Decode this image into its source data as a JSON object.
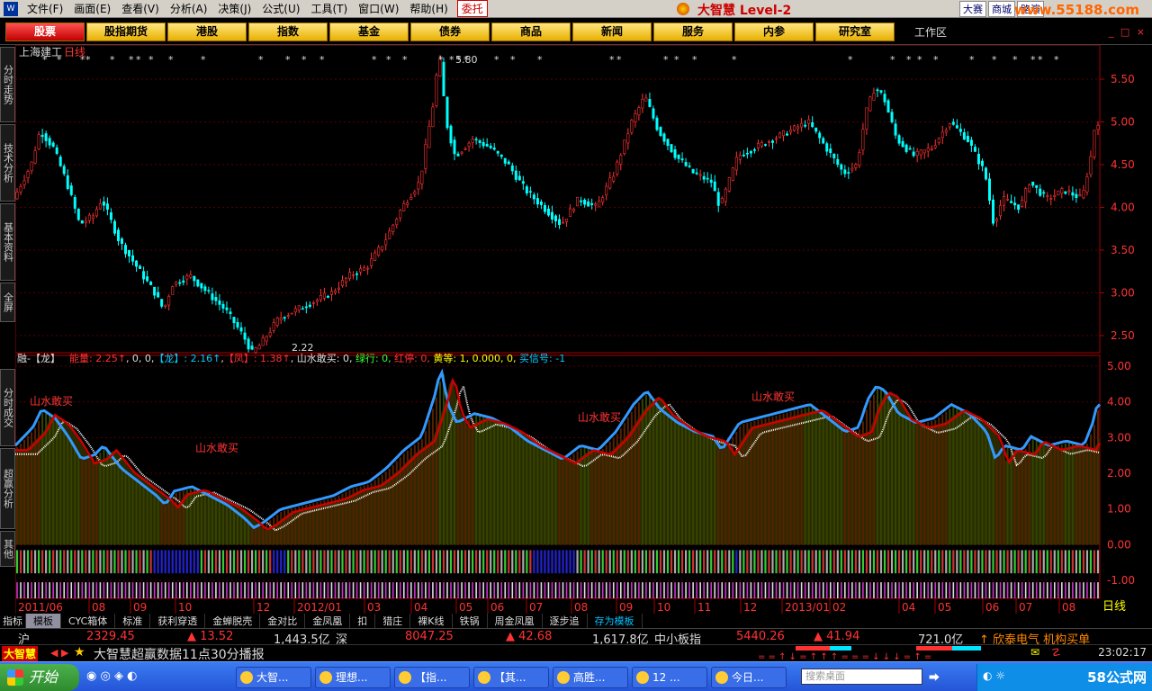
{
  "menubar": {
    "items": [
      "文件(F)",
      "画面(E)",
      "查看(V)",
      "分析(A)",
      "决策(J)",
      "公式(U)",
      "工具(T)",
      "窗口(W)",
      "帮助(H)"
    ],
    "weituo": "委托",
    "brand": "大智慧 Level-2",
    "links": [
      "大赛",
      "商城",
      "路演"
    ],
    "site": "www.55188.com"
  },
  "toolbar": {
    "buttons": [
      "股票",
      "股指期货",
      "港股",
      "指数",
      "基金",
      "债券",
      "商品",
      "新闻",
      "服务",
      "内参",
      "研究室"
    ],
    "active": "股票",
    "workarea": "工作区",
    "winctl": "_ □ ×"
  },
  "sidetabs": [
    "分时走势",
    "技术分析",
    "基本资料",
    "全屏",
    "分时成交",
    "超赢分析",
    "其他"
  ],
  "chart_data": {
    "type": "candlestick",
    "stock_name": "上海建工",
    "period": "日线",
    "price_axis": {
      "ticks": [
        "5.50",
        "5.00",
        "4.50",
        "4.00",
        "3.50",
        "3.00",
        "2.50"
      ],
      "range": [
        2.3,
        5.9
      ]
    },
    "high_label": "5.80",
    "low_label": "2.22",
    "x_labels": [
      "2011/06",
      "08",
      "09",
      "10",
      "12",
      "2012/01",
      "03",
      "04",
      "05",
      "06",
      "07",
      "08",
      "09",
      "10",
      "11",
      "12",
      "2013/01",
      "02",
      "04",
      "05",
      "06",
      "07",
      "08"
    ],
    "close_path": [
      [
        0,
        4.1
      ],
      [
        0.02,
        4.5
      ],
      [
        0.03,
        4.9
      ],
      [
        0.045,
        4.7
      ],
      [
        0.06,
        4.3
      ],
      [
        0.075,
        3.8
      ],
      [
        0.09,
        3.9
      ],
      [
        0.1,
        4.1
      ],
      [
        0.12,
        3.6
      ],
      [
        0.14,
        3.3
      ],
      [
        0.16,
        3.0
      ],
      [
        0.17,
        2.8
      ],
      [
        0.18,
        3.1
      ],
      [
        0.2,
        3.2
      ],
      [
        0.22,
        3.0
      ],
      [
        0.24,
        2.8
      ],
      [
        0.26,
        2.5
      ],
      [
        0.27,
        2.3
      ],
      [
        0.28,
        2.4
      ],
      [
        0.3,
        2.7
      ],
      [
        0.32,
        2.8
      ],
      [
        0.34,
        2.9
      ],
      [
        0.36,
        3.0
      ],
      [
        0.38,
        3.2
      ],
      [
        0.4,
        3.3
      ],
      [
        0.42,
        3.6
      ],
      [
        0.44,
        4.0
      ],
      [
        0.46,
        4.3
      ],
      [
        0.475,
        5.2
      ],
      [
        0.482,
        5.8
      ],
      [
        0.49,
        5.0
      ],
      [
        0.5,
        4.6
      ],
      [
        0.52,
        4.8
      ],
      [
        0.54,
        4.7
      ],
      [
        0.56,
        4.5
      ],
      [
        0.58,
        4.2
      ],
      [
        0.6,
        4.0
      ],
      [
        0.62,
        3.8
      ],
      [
        0.64,
        4.1
      ],
      [
        0.66,
        4.0
      ],
      [
        0.68,
        4.4
      ],
      [
        0.7,
        5.0
      ],
      [
        0.715,
        5.3
      ],
      [
        0.73,
        4.9
      ],
      [
        0.75,
        4.6
      ],
      [
        0.77,
        4.4
      ],
      [
        0.79,
        4.3
      ],
      [
        0.8,
        4.0
      ],
      [
        0.82,
        4.6
      ],
      [
        0.84,
        4.7
      ],
      [
        0.86,
        4.8
      ],
      [
        0.88,
        4.9
      ],
      [
        0.9,
        5.0
      ],
      [
        0.92,
        4.7
      ],
      [
        0.94,
        4.4
      ],
      [
        0.955,
        4.5
      ],
      [
        0.965,
        5.1
      ],
      [
        0.975,
        5.4
      ],
      [
        0.985,
        5.3
      ],
      [
        1.0,
        4.8
      ],
      [
        1.02,
        4.6
      ],
      [
        1.04,
        4.7
      ],
      [
        1.06,
        5.0
      ],
      [
        1.08,
        4.8
      ],
      [
        1.1,
        4.4
      ],
      [
        1.11,
        3.8
      ],
      [
        1.12,
        4.1
      ],
      [
        1.14,
        4.0
      ],
      [
        1.15,
        4.3
      ],
      [
        1.17,
        4.1
      ],
      [
        1.19,
        4.2
      ],
      [
        1.21,
        4.1
      ],
      [
        1.22,
        4.6
      ],
      [
        1.225,
        5.0
      ]
    ],
    "indicator": {
      "name": "融-【龙】",
      "legend": [
        {
          "t": "能量:",
          "c": "#ff3333"
        },
        {
          "t": " 2.25↑",
          "c": "#ff3333"
        },
        {
          "t": ", 0, 0,",
          "c": "#dddddd"
        },
        {
          "t": "【龙】",
          "c": "#00ccff"
        },
        {
          "t": ": 2.16↑",
          "c": "#00ccff"
        },
        {
          "t": ",",
          "c": "#dddddd"
        },
        {
          "t": "【凤】",
          "c": "#ff3333"
        },
        {
          "t": ": 1.38↑",
          "c": "#ff3333"
        },
        {
          "t": ", 山水敢买: 0,",
          "c": "#dddddd"
        },
        {
          "t": " 绿行: 0,",
          "c": "#33ff33"
        },
        {
          "t": " 红停: 0,",
          "c": "#ff3333"
        },
        {
          "t": " 黄等: 1, 0.000, 0,",
          "c": "#ffff00"
        },
        {
          "t": " 买信号: -1",
          "c": "#00ccff"
        }
      ],
      "axis_ticks": [
        "5.00",
        "4.00",
        "3.00",
        "2.00",
        "1.00",
        "0.00",
        "-1.00"
      ],
      "range": [
        -1.5,
        5.3
      ],
      "annotations": [
        "山水敢买",
        "山水敢买",
        "山水敢买",
        "山水敢买"
      ]
    }
  },
  "tabbar": {
    "first": "指标",
    "sel": "模板",
    "items": [
      "CYC箱体",
      "标准",
      "获利穿透",
      "金蝉脱壳",
      "金对比",
      "金凤凰",
      "扣",
      "猎庄",
      "裸K线",
      "铁锅",
      "周金凤凰",
      "逐步追"
    ],
    "save": "存为模板"
  },
  "status": {
    "sh": "沪",
    "sh_idx": "2329.45",
    "sh_chg": "▲ 13.52",
    "sh_amt": "1,443.5亿",
    "sz": "深",
    "sz_idx": "8047.25",
    "sz_chg": "▲ 42.68",
    "sz_amt": "1,617.8亿",
    "zx": "中小板指",
    "zx_idx": "5440.26",
    "zx_chg": "▲ 41.94",
    "zx_amt": "721.0亿",
    "news": "↑ 欣泰电气 机构买单"
  },
  "ticker": {
    "logo": "大智慧",
    "text": "大智慧超赢数据11点30分播报",
    "clock": "23:02:17",
    "side": "日线"
  },
  "taskbar": {
    "start": "开始",
    "tasks": [
      "大智...",
      "理想...",
      "【指...",
      "【其...",
      "高胜...",
      "12 ...",
      "今日..."
    ],
    "search": "搜索桌面",
    "site": "58公式网"
  },
  "colors": {
    "up": "#ff3333",
    "down": "#00ffff",
    "panel_border": "#aa0000",
    "grid": "#550000"
  }
}
